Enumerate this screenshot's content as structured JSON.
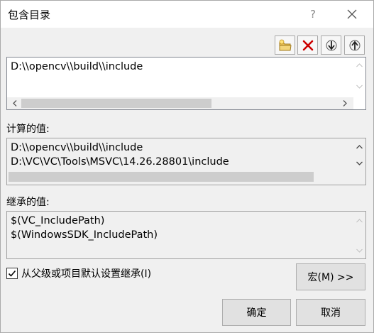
{
  "window": {
    "title": "包含目录",
    "help_label": "?",
    "close_label": "✕"
  },
  "toolbar": {
    "buttons": [
      {
        "name": "new-line",
        "icon": "folder-new-icon"
      },
      {
        "name": "delete",
        "icon": "red-x-icon"
      },
      {
        "name": "move-down",
        "icon": "arrow-down-icon"
      },
      {
        "name": "move-up",
        "icon": "arrow-up-icon"
      }
    ]
  },
  "edit_list": {
    "lines": [
      "D:\\\\opencv\\\\build\\\\include"
    ]
  },
  "computed": {
    "label": "计算的值:",
    "lines": [
      "D:\\\\opencv\\\\build\\\\include",
      "D:\\VC\\VC\\Tools\\MSVC\\14.26.28801\\include"
    ]
  },
  "inherited": {
    "label": "继承的值:",
    "lines": [
      "$(VC_IncludePath)",
      "$(WindowsSDK_IncludePath)"
    ]
  },
  "inherit_checkbox": {
    "label": "从父级或项目默认设置继承(I)",
    "checked": true
  },
  "buttons": {
    "macros": "宏(M) >>",
    "ok": "确定",
    "cancel": "取消"
  },
  "colors": {
    "background": "#f0f0f0",
    "delete_red": "#cc0000",
    "folder_yellow": "#e8c15a"
  }
}
